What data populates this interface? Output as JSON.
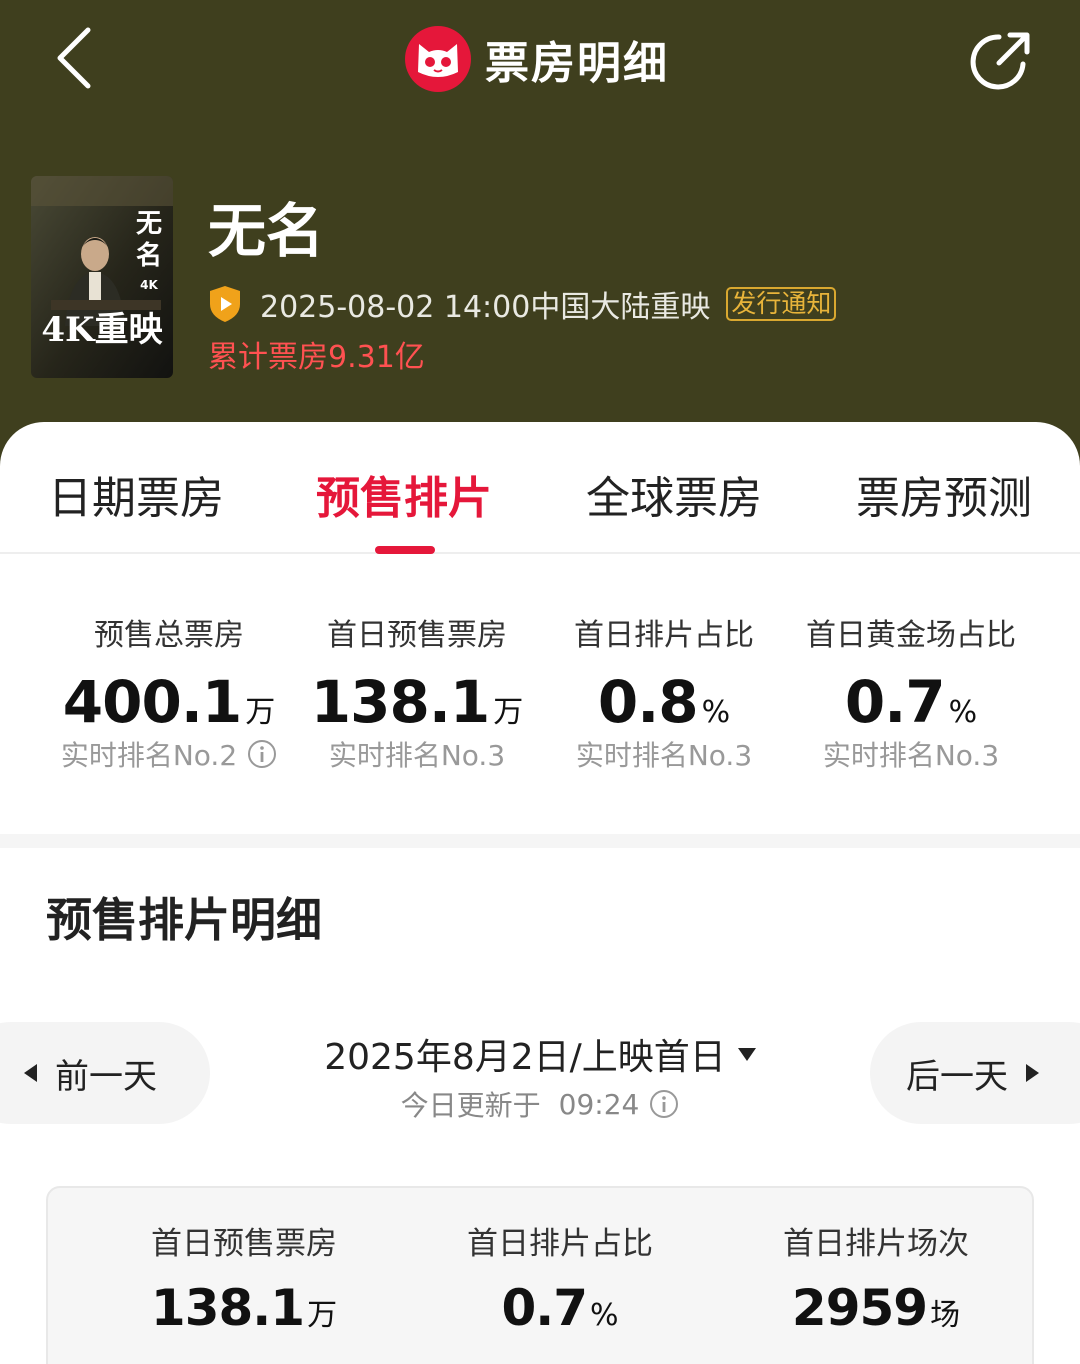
{
  "header": {
    "brand_title": "票房明细",
    "back_icon": "chevron-left-icon",
    "share_icon": "share-icon",
    "brand_logo": "maoyan-cat-logo"
  },
  "movie": {
    "title": "无名",
    "release_text": "2025-08-02 14:00中国大陆重映",
    "notice_badge": "发行通知",
    "total_box_office": "累计票房9.31亿",
    "poster_text_4k": "4K",
    "poster_text_rerelease": "4K重映",
    "poster_calligraphy": "无名"
  },
  "tabs": [
    {
      "label": "日期票房",
      "active": false
    },
    {
      "label": "预售排片",
      "active": true
    },
    {
      "label": "全球票房",
      "active": false
    },
    {
      "label": "票房预测",
      "active": false
    }
  ],
  "stats": [
    {
      "label": "预售总票房",
      "value": "400.1",
      "unit": "万",
      "rank": "实时排名No.2",
      "has_info": true
    },
    {
      "label": "首日预售票房",
      "value": "138.1",
      "unit": "万",
      "rank": "实时排名No.3",
      "has_info": false
    },
    {
      "label": "首日排片占比",
      "value": "0.8",
      "unit": "%",
      "rank": "实时排名No.3",
      "has_info": false
    },
    {
      "label": "首日黄金场占比",
      "value": "0.7",
      "unit": "%",
      "rank": "实时排名No.3",
      "has_info": false
    }
  ],
  "detail": {
    "title": "预售排片明细",
    "prev_label": "前一天",
    "next_label": "后一天",
    "date_label": "2025年8月2日/上映首日",
    "updated_prefix": "今日更新于",
    "updated_time": "09:24",
    "box_stats": [
      {
        "label": "首日预售票房",
        "value": "138.1",
        "unit": "万"
      },
      {
        "label": "首日排片占比",
        "value": "0.7",
        "unit": "%"
      },
      {
        "label": "首日排片场次",
        "value": "2959",
        "unit": "场"
      }
    ]
  },
  "colors": {
    "header_bg": "#3f3f1e",
    "accent_red": "#e5173a",
    "total_red": "#ff5151",
    "badge_gold": "#e8b43a"
  }
}
